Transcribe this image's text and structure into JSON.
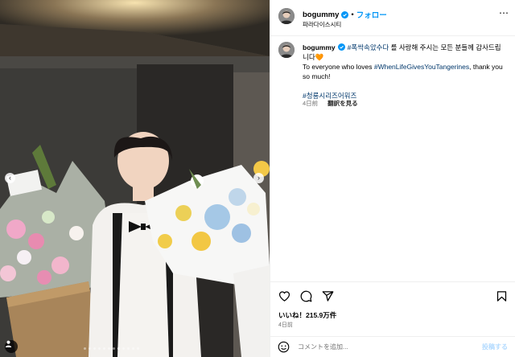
{
  "post": {
    "username": "bogummy",
    "separator": "•",
    "follow_label": "フォロー",
    "location": "파라다이스시티",
    "more_label": "...",
    "caption": {
      "username": "bogummy",
      "tag1": "#폭싹속았수다",
      "text1": "를 사랑해 주시는 모든 분들께 감사드립니다",
      "heart": "🧡",
      "text2": "To everyone who loves",
      "tag2": "#WhenLifeGivesYouTangerines",
      "text3": ", thank you so much!",
      "tag3": "#청룡시리즈어워즈"
    },
    "time_ago": "4日前",
    "translate_label": "翻訳を見る",
    "likes": "いいね！215.9万件",
    "date": "4日前",
    "comment_placeholder": "コメントを追加...",
    "post_label": "投稿する"
  },
  "carousel": {
    "prev_icon": "‹",
    "next_icon": "›",
    "dot_count": 12,
    "active_index": 7
  },
  "icons": {
    "like": "heart-icon",
    "comment": "comment-icon",
    "share": "share-icon",
    "save": "bookmark-icon",
    "emoji": "emoji-icon",
    "verified": "verified-badge-icon"
  },
  "colors": {
    "accent": "#0095f6",
    "hashtag": "#00376b",
    "muted": "#737373"
  }
}
